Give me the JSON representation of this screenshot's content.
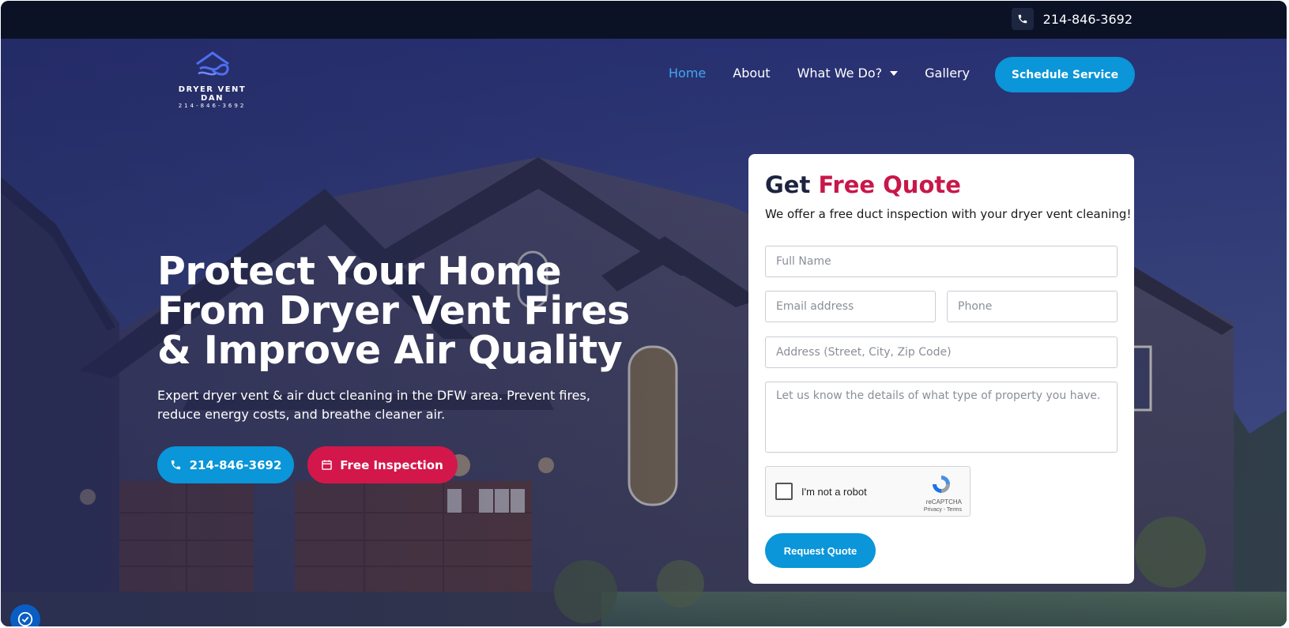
{
  "topbar": {
    "phone": "214-846-3692",
    "icon": "phone-icon"
  },
  "logo": {
    "name": "DRYER VENT DAN",
    "sub": "214-846-3692"
  },
  "nav": {
    "items": [
      {
        "label": "Home",
        "active": true
      },
      {
        "label": "About",
        "active": false
      },
      {
        "label": "What We Do?",
        "active": false,
        "dropdown": true
      },
      {
        "label": "Gallery",
        "active": false
      }
    ],
    "cta": "Schedule Service"
  },
  "hero": {
    "headline_1": "Protect Your Home",
    "headline_2": "From Dryer Vent Fires",
    "headline_3": "& Improve Air Quality",
    "subtext": "Expert dryer vent & air duct cleaning in the DFW area. Prevent fires, reduce energy costs, and breathe cleaner air.",
    "cta_phone": "214-846-3692",
    "cta_inspection": "Free Inspection"
  },
  "form": {
    "title_prefix": "Get",
    "title_accent": "Free Quote",
    "subtitle": "We offer a free duct inspection with your dryer vent cleaning!",
    "placeholders": {
      "name": "Full Name",
      "email": "Email address",
      "phone": "Phone",
      "address": "Address (Street, City, Zip Code)",
      "details": "Let us know the details of what type of property you have."
    },
    "recaptcha": {
      "label": "I'm not a robot",
      "brand": "reCAPTCHA",
      "terms": "Privacy - Terms"
    },
    "submit": "Request Quote"
  },
  "colors": {
    "accent_blue": "#0a96d8",
    "accent_red": "#d4174a",
    "nav_active": "#3fa9ee",
    "topbar_bg": "#0b1226"
  }
}
